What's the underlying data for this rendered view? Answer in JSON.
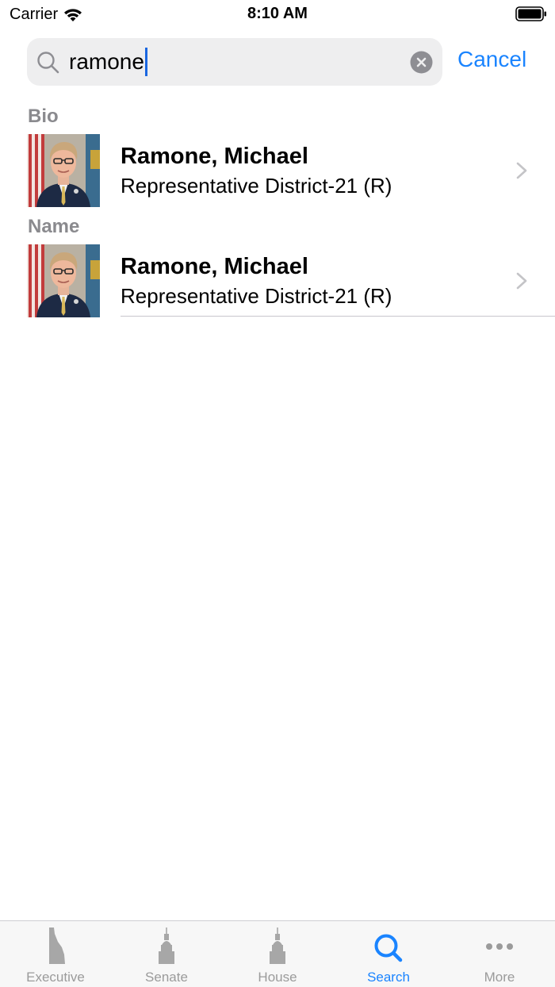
{
  "status_bar": {
    "carrier": "Carrier",
    "time": "8:10 AM"
  },
  "search": {
    "query": "ramone",
    "cancel_label": "Cancel"
  },
  "sections": [
    {
      "header": "Bio",
      "results": [
        {
          "name": "Ramone, Michael",
          "subtitle": "Representative District-21 (R)"
        }
      ]
    },
    {
      "header": "Name",
      "results": [
        {
          "name": "Ramone, Michael",
          "subtitle": "Representative District-21 (R)"
        }
      ]
    }
  ],
  "tab_bar": {
    "active_tab": "Search",
    "tabs": [
      {
        "label": "Executive",
        "icon": "delaware-state-icon"
      },
      {
        "label": "Senate",
        "icon": "capitol-building-icon"
      },
      {
        "label": "House",
        "icon": "capitol-building-icon"
      },
      {
        "label": "Search",
        "icon": "search-icon"
      },
      {
        "label": "More",
        "icon": "more-dots-icon"
      }
    ]
  },
  "colors": {
    "accent": "#1a84ff",
    "section_header": "#8a8a8e",
    "inactive_tab": "#9b9b9b",
    "search_field_bg": "#eeeeef"
  }
}
